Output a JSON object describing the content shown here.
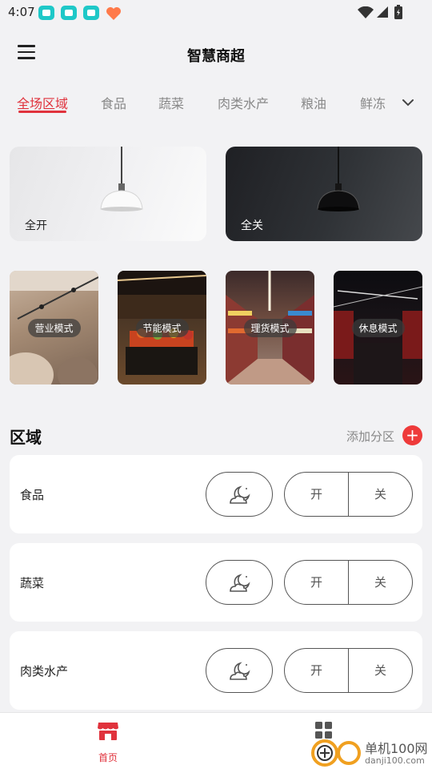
{
  "status_bar": {
    "time": "4:07",
    "app_badge_colors": [
      "#1ec8c8",
      "#1ec8c8",
      "#1ec8c8",
      "#ff7a4a"
    ]
  },
  "header": {
    "title": "智慧商超",
    "menu_icon": "hamburger-menu-icon"
  },
  "tabs": [
    {
      "label": "全场区域",
      "active": true
    },
    {
      "label": "食品",
      "active": false
    },
    {
      "label": "蔬菜",
      "active": false
    },
    {
      "label": "肉类水产",
      "active": false
    },
    {
      "label": "粮油",
      "active": false
    },
    {
      "label": "鲜冻",
      "active": false
    }
  ],
  "tabs_more_icon": "chevron-down-icon",
  "master_controls": {
    "all_on": "全开",
    "all_off": "全关"
  },
  "modes": [
    {
      "label": "营业模式"
    },
    {
      "label": "节能模式"
    },
    {
      "label": "理货模式"
    },
    {
      "label": "休息模式"
    }
  ],
  "areas_section": {
    "title": "区域",
    "add_label": "添加分区",
    "add_icon": "plus-icon",
    "zones": [
      {
        "name": "食品",
        "on": "开",
        "off": "关",
        "night_icon": "moon-cloud-icon"
      },
      {
        "name": "蔬菜",
        "on": "开",
        "off": "关",
        "night_icon": "moon-cloud-icon"
      },
      {
        "name": "肉类水产",
        "on": "开",
        "off": "关",
        "night_icon": "moon-cloud-icon"
      }
    ]
  },
  "bottom_nav": {
    "home_label": "首页",
    "home_icon": "store-icon",
    "apps_icon": "apps-grid-icon"
  },
  "watermark": {
    "line1": "单机100网",
    "line2": "danji100.com"
  },
  "colors": {
    "accent": "#e0323c",
    "add_button": "#ee3a3a",
    "background": "#f2f2f4"
  }
}
